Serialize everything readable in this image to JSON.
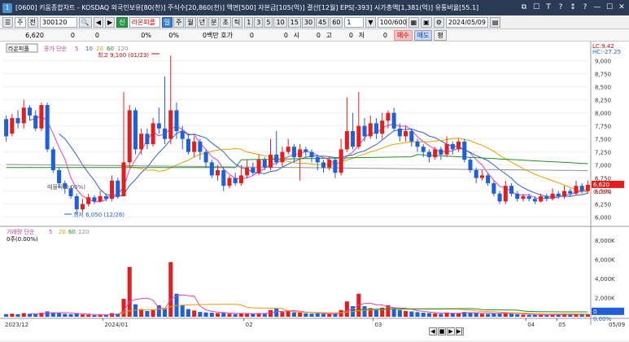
{
  "window": {
    "icon_label": "1",
    "title": "[0600] 키움종합차트 - KOSDAQ 외국인보유[80(천)] 주식수[20,860(천)] 액면[500] 자본금[105(억)] 결산[12월] EPS[-393] 시가총액[1,381(억)] 유통비율[55.1]",
    "controls": [
      "⧉",
      "☐",
      "T",
      "?",
      "↕",
      "?",
      "—",
      "☐",
      "✕"
    ]
  },
  "toolbar": {
    "stock_btn": "주",
    "prev_btn": "전",
    "code_value": "300120",
    "search_glyph": "🔍",
    "arrows": [
      "◀",
      "▶"
    ],
    "sector_tag": "신",
    "stock_name": "라온피플",
    "periods": [
      "일",
      "주",
      "월",
      "년",
      "분",
      "초",
      "틱"
    ],
    "intervals": [
      "1",
      "3",
      "5",
      "10",
      "15",
      "30",
      "45",
      "60"
    ],
    "count_value": "1",
    "range_value": "100/600",
    "date_value": "2024/05/09"
  },
  "infobar": {
    "price": "6,620",
    "f1": "0",
    "f2": "0",
    "f3": "0%",
    "f4": "0%",
    "amount": "0백만 호가",
    "q1": "0",
    "open_label": "시",
    "open": "0",
    "high_label": "고",
    "high": "0",
    "low_label": "저",
    "low": "0",
    "buy": "매수",
    "sell": "매도",
    "balance": "평"
  },
  "price_panel": {
    "stock_label": "라온피플",
    "ma_label": "종가 단순",
    "ma_periods": [
      "5",
      "10",
      "20",
      "60",
      "120"
    ],
    "ma_colors": [
      "#e040c0",
      "#3060e0",
      "#e8a000",
      "#209020",
      "#909090"
    ],
    "high_marker": "최고 9,100 (01/23)",
    "low_marker": "최저 6,050 (12/26)",
    "annotation": "매물락(0.00%)",
    "lc_label": "LC:9.42",
    "hc_label": "HC:-27.25",
    "current_price": "6,620",
    "current_pct": "0.00%",
    "y_ticks": [
      "9,000",
      "8,750",
      "8,500",
      "8,250",
      "8,000",
      "7,750",
      "7,500",
      "7,250",
      "7,000",
      "6,750",
      "6,500",
      "6,250",
      "6,000"
    ]
  },
  "volume_panel": {
    "label": "거래량 단순",
    "ma_periods": [
      "5",
      "20",
      "60",
      "120"
    ],
    "value_label": "0주(0.00%)",
    "current_value": "0",
    "current_pct": "0.00%",
    "y_ticks": [
      "8,000K",
      "6,000K",
      "4,000K",
      "2,000K"
    ]
  },
  "x_axis": {
    "labels": [
      "2023/12",
      "2024/01",
      "02",
      "03",
      "04",
      "05",
      "05/09"
    ]
  },
  "chart_data": {
    "type": "candlestick",
    "y_range": [
      5900,
      9150
    ],
    "candles": [
      {
        "o": 7880,
        "c": 7550,
        "h": 7950,
        "l": 7450,
        "v": 280
      },
      {
        "o": 7600,
        "c": 7900,
        "h": 7980,
        "l": 7550,
        "v": 320
      },
      {
        "o": 7900,
        "c": 7800,
        "h": 8050,
        "l": 7700,
        "v": 260
      },
      {
        "o": 7800,
        "c": 8100,
        "h": 8250,
        "l": 7700,
        "v": 380
      },
      {
        "o": 8100,
        "c": 7950,
        "h": 8150,
        "l": 7850,
        "v": 300
      },
      {
        "o": 7950,
        "c": 7700,
        "h": 8050,
        "l": 7650,
        "v": 280
      },
      {
        "o": 7700,
        "c": 8150,
        "h": 8200,
        "l": 7650,
        "v": 420
      },
      {
        "o": 8150,
        "c": 7300,
        "h": 8200,
        "l": 7250,
        "v": 560
      },
      {
        "o": 7300,
        "c": 6900,
        "h": 7350,
        "l": 6850,
        "v": 460
      },
      {
        "o": 6900,
        "c": 6650,
        "h": 6950,
        "l": 6550,
        "v": 380
      },
      {
        "o": 6650,
        "c": 6550,
        "h": 6700,
        "l": 6450,
        "v": 300
      },
      {
        "o": 6550,
        "c": 6400,
        "h": 6600,
        "l": 6350,
        "v": 260
      },
      {
        "o": 6400,
        "c": 6150,
        "h": 6450,
        "l": 6050,
        "v": 340
      },
      {
        "o": 6150,
        "c": 6250,
        "h": 6350,
        "l": 6100,
        "v": 240
      },
      {
        "o": 6250,
        "c": 6380,
        "h": 6450,
        "l": 6200,
        "v": 220
      },
      {
        "o": 6380,
        "c": 6300,
        "h": 6420,
        "l": 6250,
        "v": 180
      },
      {
        "o": 6300,
        "c": 6400,
        "h": 6500,
        "l": 6280,
        "v": 200
      },
      {
        "o": 6400,
        "c": 6350,
        "h": 6450,
        "l": 6300,
        "v": 160
      },
      {
        "o": 6350,
        "c": 6700,
        "h": 6800,
        "l": 6300,
        "v": 380
      },
      {
        "o": 6700,
        "c": 6400,
        "h": 6750,
        "l": 6350,
        "v": 320
      },
      {
        "o": 6400,
        "c": 7050,
        "h": 8400,
        "l": 6400,
        "v": 1860
      },
      {
        "o": 7050,
        "c": 8050,
        "h": 8150,
        "l": 6950,
        "v": 5200
      },
      {
        "o": 8050,
        "c": 7300,
        "h": 8100,
        "l": 7200,
        "v": 1300
      },
      {
        "o": 7300,
        "c": 7600,
        "h": 7700,
        "l": 7200,
        "v": 800
      },
      {
        "o": 7600,
        "c": 7400,
        "h": 7700,
        "l": 7300,
        "v": 600
      },
      {
        "o": 7400,
        "c": 7800,
        "h": 7900,
        "l": 7350,
        "v": 700
      },
      {
        "o": 7800,
        "c": 7700,
        "h": 8100,
        "l": 7600,
        "v": 1200
      },
      {
        "o": 7700,
        "c": 7500,
        "h": 8700,
        "l": 7400,
        "v": 900
      },
      {
        "o": 7500,
        "c": 8050,
        "h": 9100,
        "l": 7400,
        "v": 5700
      },
      {
        "o": 8050,
        "c": 7650,
        "h": 8200,
        "l": 7500,
        "v": 2400
      },
      {
        "o": 7650,
        "c": 7500,
        "h": 7750,
        "l": 7300,
        "v": 1200
      },
      {
        "o": 7500,
        "c": 7250,
        "h": 7600,
        "l": 7200,
        "v": 800
      },
      {
        "o": 7250,
        "c": 7450,
        "h": 7550,
        "l": 7150,
        "v": 650
      },
      {
        "o": 7450,
        "c": 7250,
        "h": 7500,
        "l": 7100,
        "v": 500
      },
      {
        "o": 7250,
        "c": 7050,
        "h": 7300,
        "l": 6950,
        "v": 450
      },
      {
        "o": 7050,
        "c": 6800,
        "h": 7100,
        "l": 6750,
        "v": 420
      },
      {
        "o": 6800,
        "c": 6900,
        "h": 7000,
        "l": 6700,
        "v": 380
      },
      {
        "o": 6900,
        "c": 6600,
        "h": 6950,
        "l": 6500,
        "v": 400
      },
      {
        "o": 6600,
        "c": 6750,
        "h": 6800,
        "l": 6550,
        "v": 320
      },
      {
        "o": 6750,
        "c": 6650,
        "h": 6850,
        "l": 6600,
        "v": 280
      },
      {
        "o": 6650,
        "c": 6800,
        "h": 7000,
        "l": 6600,
        "v": 350
      },
      {
        "o": 6800,
        "c": 6950,
        "h": 7100,
        "l": 6750,
        "v": 360
      },
      {
        "o": 6950,
        "c": 6850,
        "h": 7050,
        "l": 6800,
        "v": 300
      },
      {
        "o": 6850,
        "c": 7100,
        "h": 7200,
        "l": 6800,
        "v": 380
      },
      {
        "o": 7100,
        "c": 6950,
        "h": 7150,
        "l": 6900,
        "v": 320
      },
      {
        "o": 6950,
        "c": 7200,
        "h": 7500,
        "l": 6900,
        "v": 700
      },
      {
        "o": 7200,
        "c": 7050,
        "h": 7650,
        "l": 7000,
        "v": 900
      },
      {
        "o": 7050,
        "c": 7250,
        "h": 7350,
        "l": 6950,
        "v": 500
      },
      {
        "o": 7250,
        "c": 7350,
        "h": 7500,
        "l": 7200,
        "v": 650
      },
      {
        "o": 7350,
        "c": 7150,
        "h": 7400,
        "l": 7050,
        "v": 450
      },
      {
        "o": 7150,
        "c": 7300,
        "h": 7400,
        "l": 6700,
        "v": 420
      },
      {
        "o": 7300,
        "c": 7250,
        "h": 7350,
        "l": 7150,
        "v": 360
      },
      {
        "o": 7250,
        "c": 7150,
        "h": 7300,
        "l": 7050,
        "v": 320
      },
      {
        "o": 7150,
        "c": 7050,
        "h": 7200,
        "l": 6900,
        "v": 340
      },
      {
        "o": 7050,
        "c": 6950,
        "h": 7100,
        "l": 6850,
        "v": 300
      },
      {
        "o": 6950,
        "c": 7100,
        "h": 7150,
        "l": 6900,
        "v": 280
      },
      {
        "o": 7100,
        "c": 6850,
        "h": 7150,
        "l": 6750,
        "v": 320
      },
      {
        "o": 6850,
        "c": 7300,
        "h": 7500,
        "l": 6800,
        "v": 700
      },
      {
        "o": 7300,
        "c": 7650,
        "h": 8300,
        "l": 7250,
        "v": 1600
      },
      {
        "o": 7650,
        "c": 7350,
        "h": 8000,
        "l": 7300,
        "v": 1100
      },
      {
        "o": 7350,
        "c": 7750,
        "h": 8400,
        "l": 7300,
        "v": 2400
      },
      {
        "o": 7750,
        "c": 7550,
        "h": 7900,
        "l": 7450,
        "v": 1100
      },
      {
        "o": 7550,
        "c": 7800,
        "h": 7950,
        "l": 7500,
        "v": 900
      },
      {
        "o": 7800,
        "c": 7600,
        "h": 7900,
        "l": 7500,
        "v": 800
      },
      {
        "o": 7600,
        "c": 7850,
        "h": 8000,
        "l": 7500,
        "v": 950
      },
      {
        "o": 7850,
        "c": 8000,
        "h": 8050,
        "l": 7700,
        "v": 1200
      },
      {
        "o": 8000,
        "c": 7700,
        "h": 8100,
        "l": 7650,
        "v": 900
      },
      {
        "o": 7700,
        "c": 7550,
        "h": 7800,
        "l": 7450,
        "v": 700
      },
      {
        "o": 7550,
        "c": 7650,
        "h": 7750,
        "l": 7450,
        "v": 600
      },
      {
        "o": 7650,
        "c": 7450,
        "h": 7700,
        "l": 7350,
        "v": 550
      },
      {
        "o": 7450,
        "c": 7350,
        "h": 7500,
        "l": 7250,
        "v": 480
      },
      {
        "o": 7350,
        "c": 7250,
        "h": 7400,
        "l": 7150,
        "v": 420
      },
      {
        "o": 7250,
        "c": 7150,
        "h": 7300,
        "l": 7050,
        "v": 380
      },
      {
        "o": 7150,
        "c": 7300,
        "h": 7350,
        "l": 7100,
        "v": 350
      },
      {
        "o": 7300,
        "c": 7200,
        "h": 7350,
        "l": 7100,
        "v": 300
      },
      {
        "o": 7200,
        "c": 7400,
        "h": 7550,
        "l": 7150,
        "v": 450
      },
      {
        "o": 7400,
        "c": 7300,
        "h": 7450,
        "l": 7200,
        "v": 380
      },
      {
        "o": 7300,
        "c": 7450,
        "h": 7500,
        "l": 7250,
        "v": 350
      },
      {
        "o": 7450,
        "c": 7100,
        "h": 7500,
        "l": 7050,
        "v": 500
      },
      {
        "o": 7100,
        "c": 6900,
        "h": 7150,
        "l": 6850,
        "v": 460
      },
      {
        "o": 6900,
        "c": 6750,
        "h": 6950,
        "l": 6650,
        "v": 400
      },
      {
        "o": 6750,
        "c": 6800,
        "h": 6900,
        "l": 6700,
        "v": 320
      },
      {
        "o": 6800,
        "c": 6650,
        "h": 6850,
        "l": 6600,
        "v": 300
      },
      {
        "o": 6650,
        "c": 6450,
        "h": 6700,
        "l": 6400,
        "v": 360
      },
      {
        "o": 6450,
        "c": 6300,
        "h": 6500,
        "l": 6250,
        "v": 380
      },
      {
        "o": 6300,
        "c": 6600,
        "h": 6700,
        "l": 6250,
        "v": 420
      },
      {
        "o": 6600,
        "c": 6450,
        "h": 6650,
        "l": 6400,
        "v": 300
      },
      {
        "o": 6450,
        "c": 6350,
        "h": 6500,
        "l": 6300,
        "v": 260
      },
      {
        "o": 6350,
        "c": 6400,
        "h": 6450,
        "l": 6300,
        "v": 220
      },
      {
        "o": 6400,
        "c": 6350,
        "h": 6450,
        "l": 6300,
        "v": 200
      },
      {
        "o": 6350,
        "c": 6300,
        "h": 6400,
        "l": 6250,
        "v": 200
      },
      {
        "o": 6300,
        "c": 6400,
        "h": 6450,
        "l": 6280,
        "v": 220
      },
      {
        "o": 6400,
        "c": 6350,
        "h": 6450,
        "l": 6300,
        "v": 200
      },
      {
        "o": 6350,
        "c": 6450,
        "h": 6550,
        "l": 6320,
        "v": 250
      },
      {
        "o": 6450,
        "c": 6400,
        "h": 6500,
        "l": 6350,
        "v": 220
      },
      {
        "o": 6400,
        "c": 6500,
        "h": 6600,
        "l": 6350,
        "v": 280
      },
      {
        "o": 6500,
        "c": 6450,
        "h": 6550,
        "l": 6400,
        "v": 240
      },
      {
        "o": 6450,
        "c": 6600,
        "h": 6700,
        "l": 6420,
        "v": 300
      },
      {
        "o": 6600,
        "c": 6500,
        "h": 6650,
        "l": 6450,
        "v": 260
      },
      {
        "o": 6500,
        "c": 6620,
        "h": 6700,
        "l": 6450,
        "v": 280
      }
    ]
  }
}
